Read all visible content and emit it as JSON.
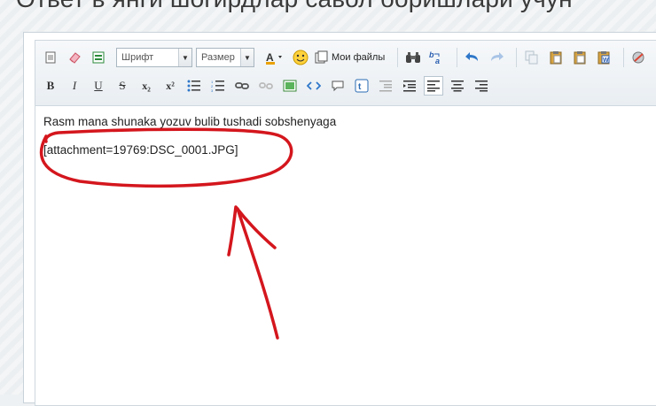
{
  "page": {
    "title": "Ответ в янги шогирдлар савол боришлари учун"
  },
  "toolbar": {
    "row1": {
      "font_select": "Шрифт",
      "size_select": "Размер",
      "files_label": "Мои файлы"
    },
    "row2": {
      "bold": "B",
      "italic": "I",
      "underline": "U",
      "strike": "S",
      "subscript": "x₂",
      "superscript": "x²"
    }
  },
  "editor": {
    "line1": "Rasm mana shunaka yozuv bulib tushadi sobshenyaga",
    "line2": "[attachment=19769:DSC_0001.JPG]"
  },
  "colors": {
    "annotation": "#d4161d",
    "accent": "#2f77c9"
  }
}
